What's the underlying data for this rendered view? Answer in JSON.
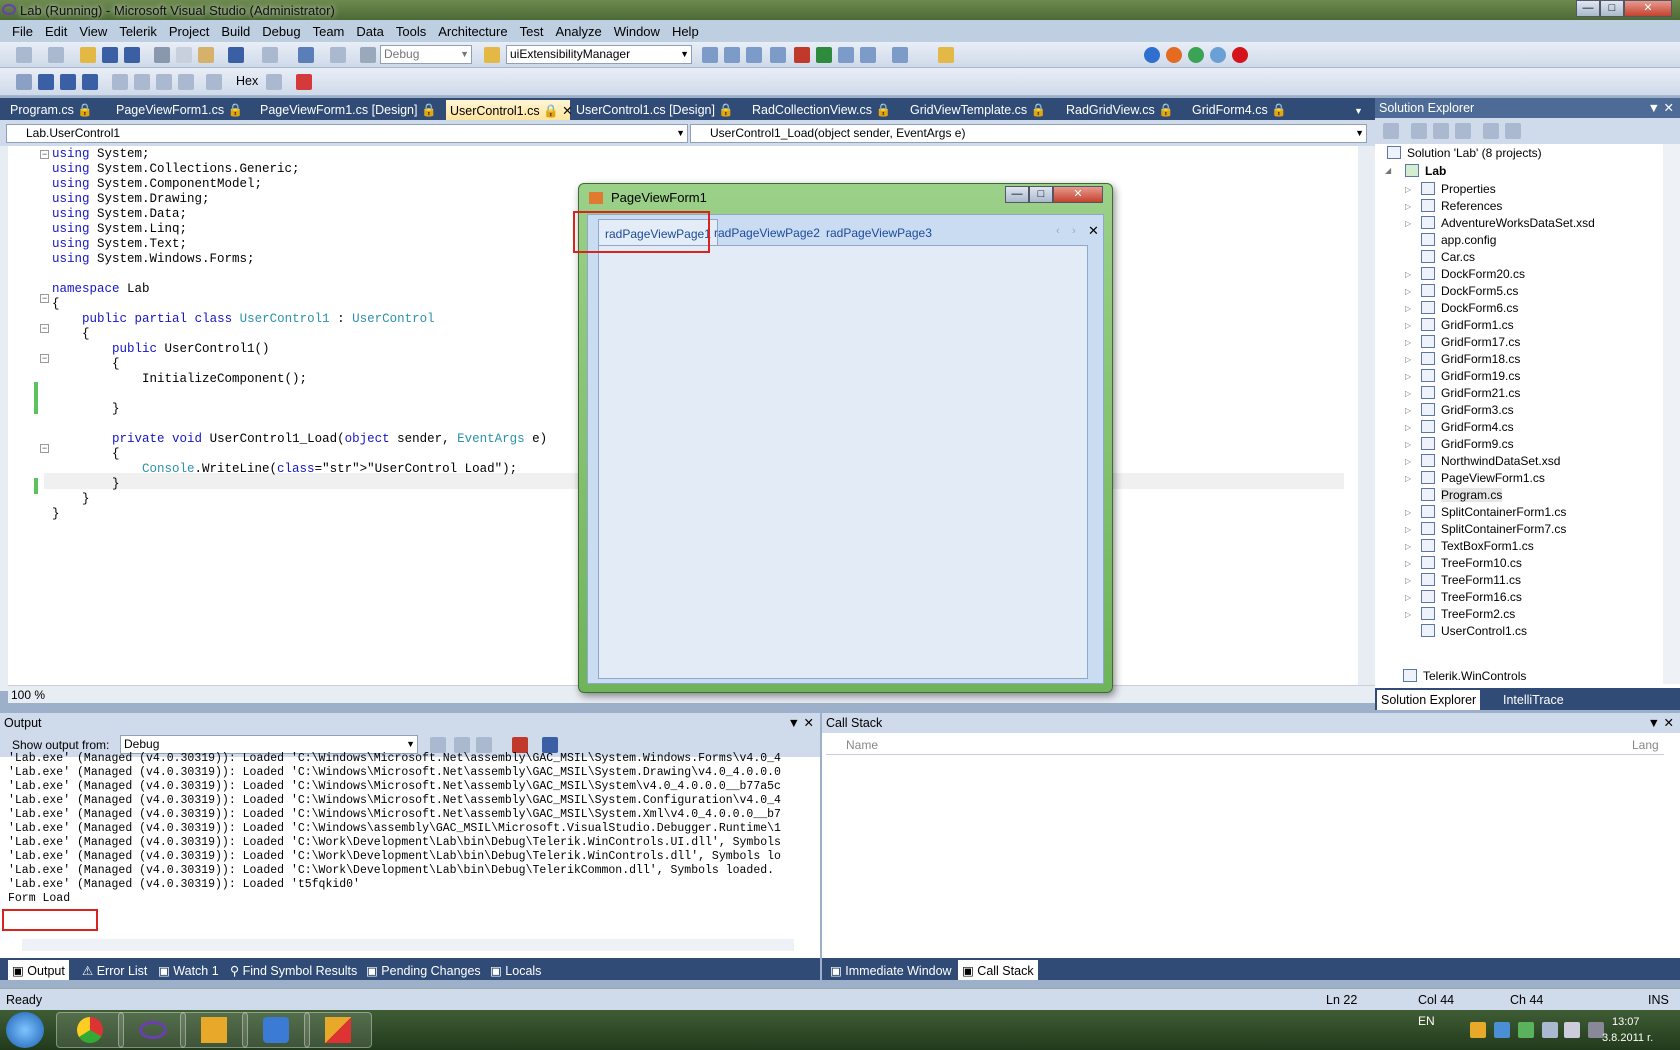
{
  "window": {
    "title": "Lab (Running) - Microsoft Visual Studio (Administrator)"
  },
  "menu": [
    "File",
    "Edit",
    "View",
    "Telerik",
    "Project",
    "Build",
    "Debug",
    "Team",
    "Data",
    "Tools",
    "Architecture",
    "Test",
    "Analyze",
    "Window",
    "Help"
  ],
  "toolbar": {
    "config": "Debug",
    "find_combo": "uiExtensibilityManager",
    "hex_label": "Hex"
  },
  "doc_tabs": [
    {
      "label": "Program.cs",
      "active": false
    },
    {
      "label": "PageViewForm1.cs",
      "active": false
    },
    {
      "label": "PageViewForm1.cs [Design]",
      "active": false
    },
    {
      "label": "UserControl1.cs",
      "active": true
    },
    {
      "label": "UserControl1.cs [Design]",
      "active": false
    },
    {
      "label": "RadCollectionView.cs",
      "active": false
    },
    {
      "label": "GridViewTemplate.cs",
      "active": false
    },
    {
      "label": "RadGridView.cs",
      "active": false
    },
    {
      "label": "GridForm4.cs",
      "active": false
    }
  ],
  "nav": {
    "class_combo": "Lab.UserControl1",
    "member_combo": "UserControl1_Load(object sender, EventArgs e)"
  },
  "editor": {
    "zoom": "100 %",
    "lines": [
      "using System;",
      "using System.Collections.Generic;",
      "using System.ComponentModel;",
      "using System.Drawing;",
      "using System.Data;",
      "using System.Linq;",
      "using System.Text;",
      "using System.Windows.Forms;",
      "",
      "namespace Lab",
      "{",
      "    public partial class UserControl1 : UserControl",
      "    {",
      "        public UserControl1()",
      "        {",
      "            InitializeComponent();",
      "",
      "        }",
      "",
      "        private void UserControl1_Load(object sender, EventArgs e)",
      "        {",
      "            Console.WriteLine(\"UserControl Load\");",
      "        }",
      "    }",
      "}"
    ]
  },
  "page_view_form": {
    "title": "PageViewForm1",
    "tabs": [
      "radPageViewPage1",
      "radPageViewPage2",
      "radPageViewPage3"
    ],
    "selected_tab": "radPageViewPage1"
  },
  "solution_explorer": {
    "title": "Solution Explorer",
    "solution": "Solution 'Lab' (8 projects)",
    "project": "Lab",
    "items": [
      "Properties",
      "References",
      "AdventureWorksDataSet.xsd",
      "app.config",
      "Car.cs",
      "DockForm20.cs",
      "DockForm5.cs",
      "DockForm6.cs",
      "GridForm1.cs",
      "GridForm17.cs",
      "GridForm18.cs",
      "GridForm19.cs",
      "GridForm21.cs",
      "GridForm3.cs",
      "GridForm4.cs",
      "GridForm9.cs",
      "NorthwindDataSet.xsd",
      "PageViewForm1.cs",
      "Program.cs",
      "SplitContainerForm1.cs",
      "SplitContainerForm7.cs",
      "TextBoxForm1.cs",
      "TreeForm10.cs",
      "TreeForm11.cs",
      "TreeForm16.cs",
      "TreeForm2.cs",
      "UserControl1.cs"
    ],
    "next_project": "Telerik.WinControls",
    "tabs": [
      "Solution Explorer",
      "IntelliTrace"
    ]
  },
  "output": {
    "title": "Output",
    "show_from_label": "Show output from:",
    "show_from_value": "Debug",
    "lines": [
      "'Lab.exe' (Managed (v4.0.30319)): Loaded 'C:\\Windows\\Microsoft.Net\\assembly\\GAC_MSIL\\System.Windows.Forms\\v4.0_4",
      "'Lab.exe' (Managed (v4.0.30319)): Loaded 'C:\\Windows\\Microsoft.Net\\assembly\\GAC_MSIL\\System.Drawing\\v4.0_4.0.0.0",
      "'Lab.exe' (Managed (v4.0.30319)): Loaded 'C:\\Windows\\Microsoft.Net\\assembly\\GAC_MSIL\\System\\v4.0_4.0.0.0__b77a5c",
      "'Lab.exe' (Managed (v4.0.30319)): Loaded 'C:\\Windows\\Microsoft.Net\\assembly\\GAC_MSIL\\System.Configuration\\v4.0_4",
      "'Lab.exe' (Managed (v4.0.30319)): Loaded 'C:\\Windows\\Microsoft.Net\\assembly\\GAC_MSIL\\System.Xml\\v4.0_4.0.0.0__b7",
      "'Lab.exe' (Managed (v4.0.30319)): Loaded 'C:\\Windows\\assembly\\GAC_MSIL\\Microsoft.VisualStudio.Debugger.Runtime\\1",
      "'Lab.exe' (Managed (v4.0.30319)): Loaded 'C:\\Work\\Development\\Lab\\bin\\Debug\\Telerik.WinControls.UI.dll', Symbols",
      "'Lab.exe' (Managed (v4.0.30319)): Loaded 'C:\\Work\\Development\\Lab\\bin\\Debug\\Telerik.WinControls.dll', Symbols lo",
      "'Lab.exe' (Managed (v4.0.30319)): Loaded 'C:\\Work\\Development\\Lab\\bin\\Debug\\TelerikCommon.dll', Symbols loaded.",
      "'Lab.exe' (Managed (v4.0.30319)): Loaded 't5fqkid0'",
      "Form Load"
    ],
    "tabs": [
      "Output",
      "Error List",
      "Watch 1",
      "Find Symbol Results",
      "Pending Changes",
      "Locals"
    ]
  },
  "call_stack": {
    "title": "Call Stack",
    "col_name": "Name",
    "col_lang": "Lang",
    "tabs": [
      "Immediate Window",
      "Call Stack"
    ]
  },
  "status": {
    "text": "Ready",
    "ln": "Ln 22",
    "col": "Col 44",
    "ch": "Ch 44",
    "ins": "INS"
  },
  "tray": {
    "lang": "EN",
    "time": "13:07",
    "date": "3.8.2011 r."
  }
}
